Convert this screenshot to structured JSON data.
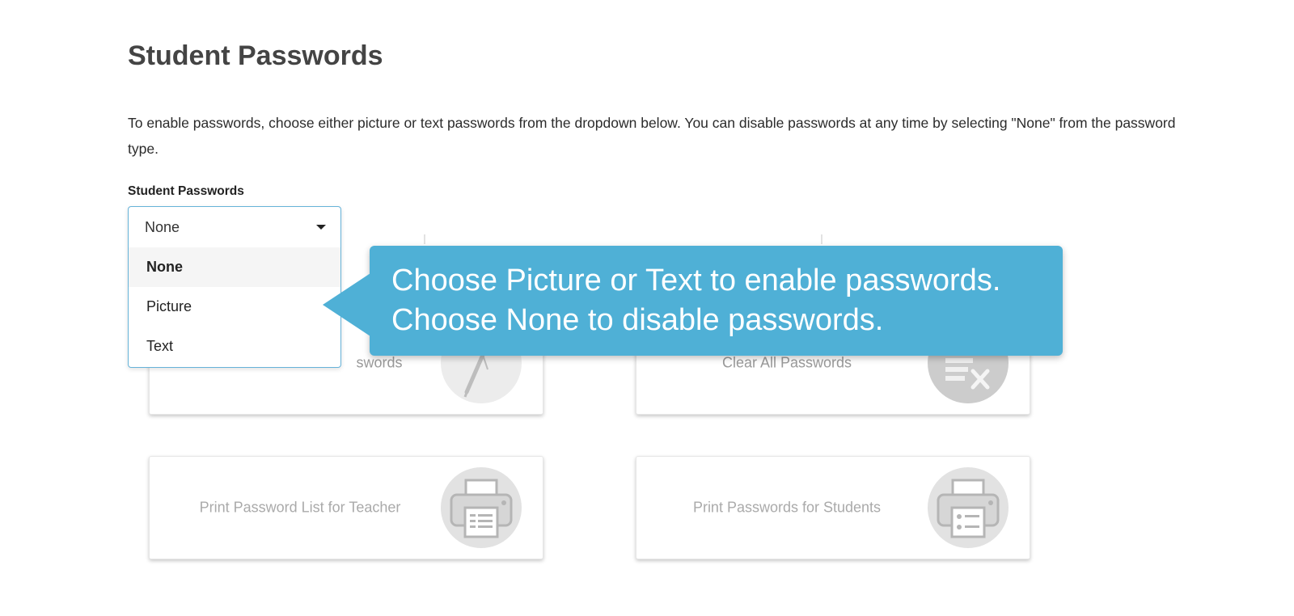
{
  "page": {
    "title": "Student Passwords",
    "intro": "To enable passwords, choose either picture or text passwords from the dropdown below. You can disable passwords at any time by selecting \"None\" from the password type."
  },
  "password_select": {
    "label": "Student Passwords",
    "current_value": "None",
    "options": [
      "None",
      "Picture",
      "Text"
    ],
    "selected": "None"
  },
  "callout": {
    "line1": "Choose Picture or Text to enable passwords.",
    "line2": "Choose None to disable passwords.",
    "color": "#4fb0d6"
  },
  "cards": [
    {
      "label_visible": "swords",
      "icon": "pencil-icon"
    },
    {
      "label": "Clear All Passwords",
      "icon": "clear-list-icon"
    },
    {
      "label": "Print Password List for Teacher",
      "icon": "printer-list-icon"
    },
    {
      "label": "Print Passwords for Students",
      "icon": "printer-cards-icon"
    }
  ],
  "colors": {
    "accent_border": "#66b3d9",
    "disabled_text": "#aaaaaa"
  }
}
